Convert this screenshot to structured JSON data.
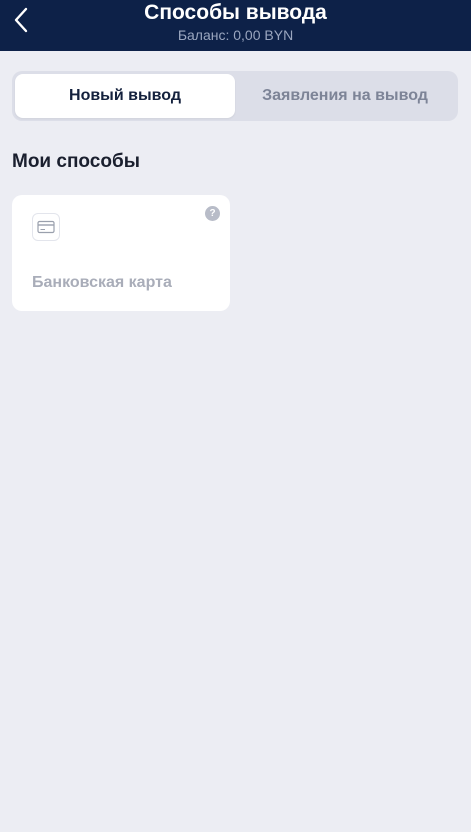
{
  "header": {
    "title": "Способы вывода",
    "balance": "Баланс: 0,00 BYN",
    "back_icon": "chevron-left-icon"
  },
  "tabs": [
    {
      "label": "Новый вывод",
      "active": true
    },
    {
      "label": "Заявления на вывод",
      "active": false
    }
  ],
  "section": {
    "title": "Мои способы"
  },
  "methods": [
    {
      "label": "Банковская карта",
      "icon": "credit-card-icon",
      "help": "?"
    }
  ],
  "colors": {
    "header_bg": "#0d2148",
    "page_bg": "#ecedf3",
    "card_bg": "#ffffff",
    "muted_text": "#a9adb9"
  }
}
